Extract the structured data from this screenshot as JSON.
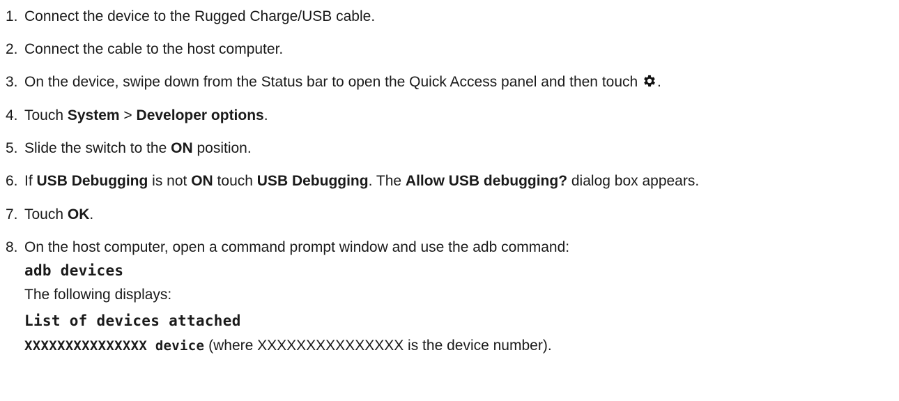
{
  "steps": [
    {
      "num": "1.",
      "text": "Connect the device to the Rugged Charge/USB cable."
    },
    {
      "num": "2.",
      "text": "Connect the cable to the host computer."
    },
    {
      "num": "3.",
      "pre": "On the device, swipe down from the Status bar to open the Quick Access panel and then touch ",
      "icon": "gear-icon",
      "post": "."
    },
    {
      "num": "4.",
      "pre": "Touch ",
      "b1": "System",
      "mid": " > ",
      "b2": "Developer options",
      "post": "."
    },
    {
      "num": "5.",
      "pre": "Slide the switch to the ",
      "b1": "ON",
      "post": " position."
    },
    {
      "num": "6.",
      "pre": "If ",
      "b1": "USB Debugging",
      "mid1": " is not ",
      "b2": "ON",
      "mid2": " touch ",
      "b3": "USB Debugging",
      "mid3": ". The ",
      "b4": "Allow USB debugging?",
      "post": " dialog box appears."
    },
    {
      "num": "7.",
      "pre": "Touch ",
      "b1": "OK",
      "post": "."
    },
    {
      "num": "8.",
      "text": "On the host computer, open a command prompt window and use the adb command:"
    }
  ],
  "step8_detail": {
    "command": "adb devices",
    "displays_label": "The following displays:",
    "output_line1": "List of devices attached",
    "output_line2_code": "XXXXXXXXXXXXXXX device",
    "output_line2_text": " (where XXXXXXXXXXXXXXX is the device number)."
  }
}
